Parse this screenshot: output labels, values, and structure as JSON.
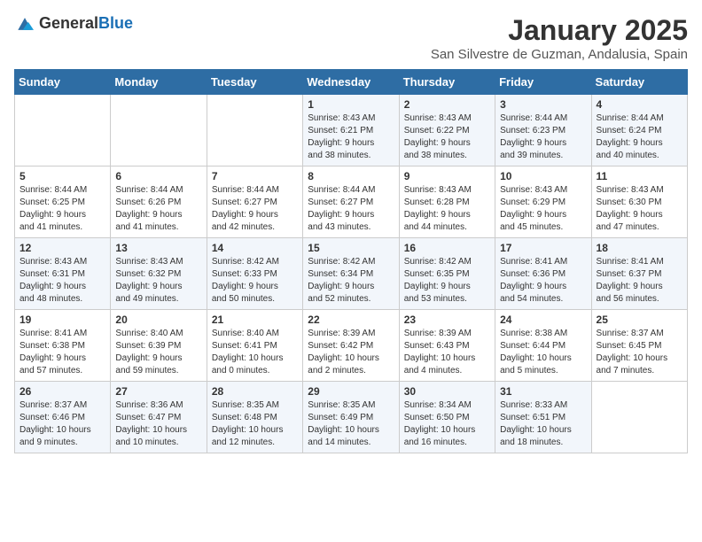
{
  "header": {
    "logo_general": "General",
    "logo_blue": "Blue",
    "title": "January 2025",
    "subtitle": "San Silvestre de Guzman, Andalusia, Spain"
  },
  "days_of_week": [
    "Sunday",
    "Monday",
    "Tuesday",
    "Wednesday",
    "Thursday",
    "Friday",
    "Saturday"
  ],
  "weeks": [
    [
      {
        "day": "",
        "info": ""
      },
      {
        "day": "",
        "info": ""
      },
      {
        "day": "",
        "info": ""
      },
      {
        "day": "1",
        "info": "Sunrise: 8:43 AM\nSunset: 6:21 PM\nDaylight: 9 hours\nand 38 minutes."
      },
      {
        "day": "2",
        "info": "Sunrise: 8:43 AM\nSunset: 6:22 PM\nDaylight: 9 hours\nand 38 minutes."
      },
      {
        "day": "3",
        "info": "Sunrise: 8:44 AM\nSunset: 6:23 PM\nDaylight: 9 hours\nand 39 minutes."
      },
      {
        "day": "4",
        "info": "Sunrise: 8:44 AM\nSunset: 6:24 PM\nDaylight: 9 hours\nand 40 minutes."
      }
    ],
    [
      {
        "day": "5",
        "info": "Sunrise: 8:44 AM\nSunset: 6:25 PM\nDaylight: 9 hours\nand 41 minutes."
      },
      {
        "day": "6",
        "info": "Sunrise: 8:44 AM\nSunset: 6:26 PM\nDaylight: 9 hours\nand 41 minutes."
      },
      {
        "day": "7",
        "info": "Sunrise: 8:44 AM\nSunset: 6:27 PM\nDaylight: 9 hours\nand 42 minutes."
      },
      {
        "day": "8",
        "info": "Sunrise: 8:44 AM\nSunset: 6:27 PM\nDaylight: 9 hours\nand 43 minutes."
      },
      {
        "day": "9",
        "info": "Sunrise: 8:43 AM\nSunset: 6:28 PM\nDaylight: 9 hours\nand 44 minutes."
      },
      {
        "day": "10",
        "info": "Sunrise: 8:43 AM\nSunset: 6:29 PM\nDaylight: 9 hours\nand 45 minutes."
      },
      {
        "day": "11",
        "info": "Sunrise: 8:43 AM\nSunset: 6:30 PM\nDaylight: 9 hours\nand 47 minutes."
      }
    ],
    [
      {
        "day": "12",
        "info": "Sunrise: 8:43 AM\nSunset: 6:31 PM\nDaylight: 9 hours\nand 48 minutes."
      },
      {
        "day": "13",
        "info": "Sunrise: 8:43 AM\nSunset: 6:32 PM\nDaylight: 9 hours\nand 49 minutes."
      },
      {
        "day": "14",
        "info": "Sunrise: 8:42 AM\nSunset: 6:33 PM\nDaylight: 9 hours\nand 50 minutes."
      },
      {
        "day": "15",
        "info": "Sunrise: 8:42 AM\nSunset: 6:34 PM\nDaylight: 9 hours\nand 52 minutes."
      },
      {
        "day": "16",
        "info": "Sunrise: 8:42 AM\nSunset: 6:35 PM\nDaylight: 9 hours\nand 53 minutes."
      },
      {
        "day": "17",
        "info": "Sunrise: 8:41 AM\nSunset: 6:36 PM\nDaylight: 9 hours\nand 54 minutes."
      },
      {
        "day": "18",
        "info": "Sunrise: 8:41 AM\nSunset: 6:37 PM\nDaylight: 9 hours\nand 56 minutes."
      }
    ],
    [
      {
        "day": "19",
        "info": "Sunrise: 8:41 AM\nSunset: 6:38 PM\nDaylight: 9 hours\nand 57 minutes."
      },
      {
        "day": "20",
        "info": "Sunrise: 8:40 AM\nSunset: 6:39 PM\nDaylight: 9 hours\nand 59 minutes."
      },
      {
        "day": "21",
        "info": "Sunrise: 8:40 AM\nSunset: 6:41 PM\nDaylight: 10 hours\nand 0 minutes."
      },
      {
        "day": "22",
        "info": "Sunrise: 8:39 AM\nSunset: 6:42 PM\nDaylight: 10 hours\nand 2 minutes."
      },
      {
        "day": "23",
        "info": "Sunrise: 8:39 AM\nSunset: 6:43 PM\nDaylight: 10 hours\nand 4 minutes."
      },
      {
        "day": "24",
        "info": "Sunrise: 8:38 AM\nSunset: 6:44 PM\nDaylight: 10 hours\nand 5 minutes."
      },
      {
        "day": "25",
        "info": "Sunrise: 8:37 AM\nSunset: 6:45 PM\nDaylight: 10 hours\nand 7 minutes."
      }
    ],
    [
      {
        "day": "26",
        "info": "Sunrise: 8:37 AM\nSunset: 6:46 PM\nDaylight: 10 hours\nand 9 minutes."
      },
      {
        "day": "27",
        "info": "Sunrise: 8:36 AM\nSunset: 6:47 PM\nDaylight: 10 hours\nand 10 minutes."
      },
      {
        "day": "28",
        "info": "Sunrise: 8:35 AM\nSunset: 6:48 PM\nDaylight: 10 hours\nand 12 minutes."
      },
      {
        "day": "29",
        "info": "Sunrise: 8:35 AM\nSunset: 6:49 PM\nDaylight: 10 hours\nand 14 minutes."
      },
      {
        "day": "30",
        "info": "Sunrise: 8:34 AM\nSunset: 6:50 PM\nDaylight: 10 hours\nand 16 minutes."
      },
      {
        "day": "31",
        "info": "Sunrise: 8:33 AM\nSunset: 6:51 PM\nDaylight: 10 hours\nand 18 minutes."
      },
      {
        "day": "",
        "info": ""
      }
    ]
  ]
}
